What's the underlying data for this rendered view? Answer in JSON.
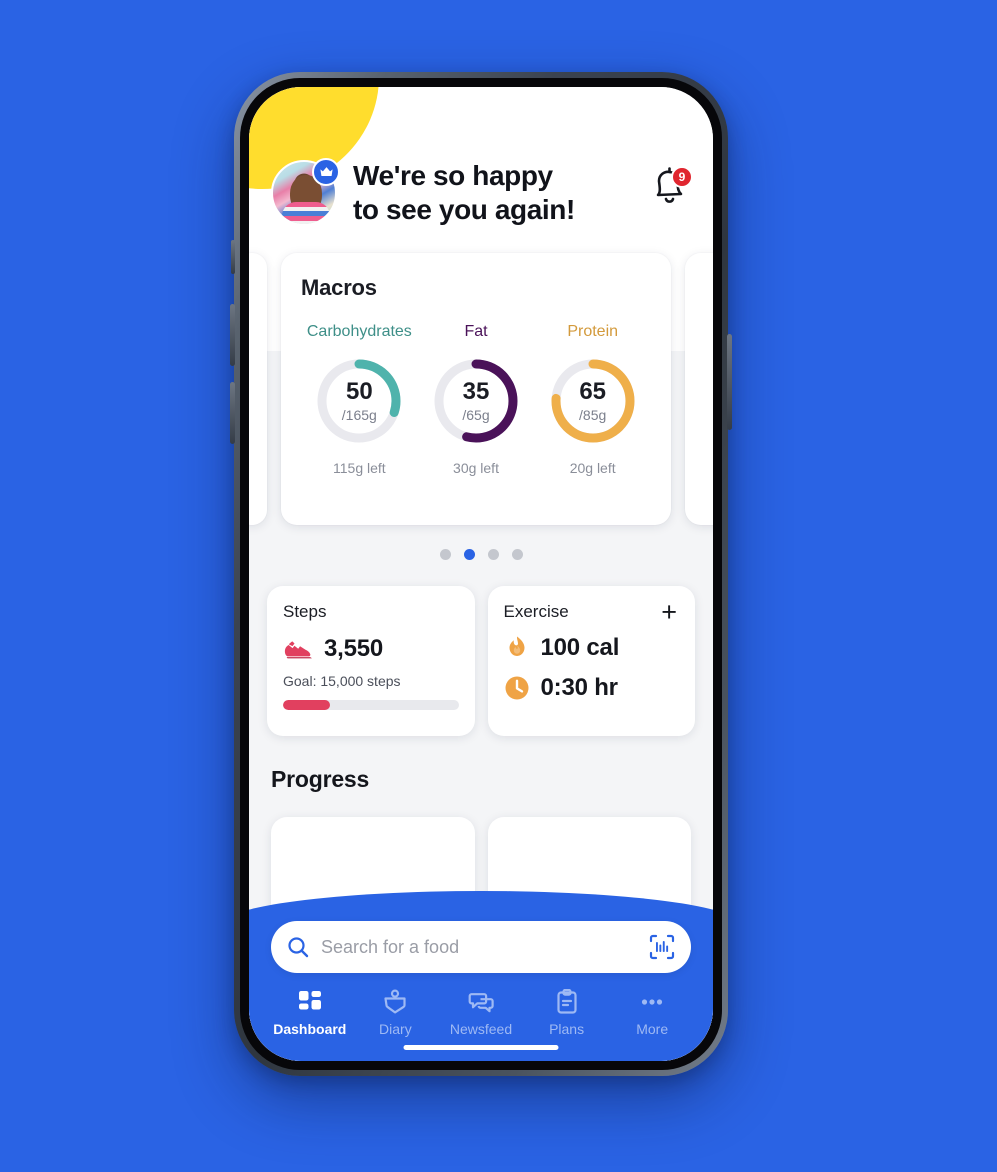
{
  "theme": {
    "background_blue": "#2A63E4",
    "accent_blue": "#2A63E4",
    "carb_color": "#4FB3AC",
    "fat_color": "#4A1259",
    "protein_color": "#EFAF4A",
    "steps_color": "#E1405F",
    "exercise_color": "#EFA345",
    "badge_red": "#E0262F",
    "blob_yellow": "#FFDD2D",
    "ring_track": "#E9E9EE"
  },
  "header": {
    "avatar_name": "user-avatar",
    "crown_badge_icon": "crown-icon",
    "greeting_line1": "We're so happy",
    "greeting_line2": "to see you again!",
    "bell_icon": "bell-icon",
    "notification_count": "9"
  },
  "macros": {
    "title": "Macros",
    "items": [
      {
        "label": "Carbohydrates",
        "value": "50",
        "goal": "/165g",
        "left": "115g left",
        "color": "#4FB3AC",
        "percent": 30
      },
      {
        "label": "Fat",
        "value": "35",
        "goal": "/65g",
        "left": "30g left",
        "color": "#4A1259",
        "percent": 54
      },
      {
        "label": "Protein",
        "value": "65",
        "goal": "/85g",
        "left": "20g left",
        "color": "#EFAF4A",
        "percent": 76
      }
    ]
  },
  "carousel": {
    "total_dots": 4,
    "active_index": 1
  },
  "steps": {
    "title": "Steps",
    "icon": "running-shoe-icon",
    "value": "3,550",
    "goal": "Goal: 15,000 steps",
    "progress_percent": 27
  },
  "exercise": {
    "title": "Exercise",
    "add_label": "+",
    "calories_icon": "flame-icon",
    "calories": "100 cal",
    "duration_icon": "clock-icon",
    "duration": "0:30 hr"
  },
  "progress": {
    "title": "Progress"
  },
  "search": {
    "icon": "search-icon",
    "placeholder": "Search for a food",
    "value": "",
    "scan_icon": "barcode-scan-icon"
  },
  "bottom_nav": {
    "items": [
      {
        "label": "Dashboard",
        "icon": "dashboard-grid-icon",
        "active": true
      },
      {
        "label": "Diary",
        "icon": "diary-book-icon",
        "active": false
      },
      {
        "label": "Newsfeed",
        "icon": "chat-bubbles-icon",
        "active": false
      },
      {
        "label": "Plans",
        "icon": "clipboard-icon",
        "active": false
      },
      {
        "label": "More",
        "icon": "ellipsis-icon",
        "active": false
      }
    ]
  }
}
